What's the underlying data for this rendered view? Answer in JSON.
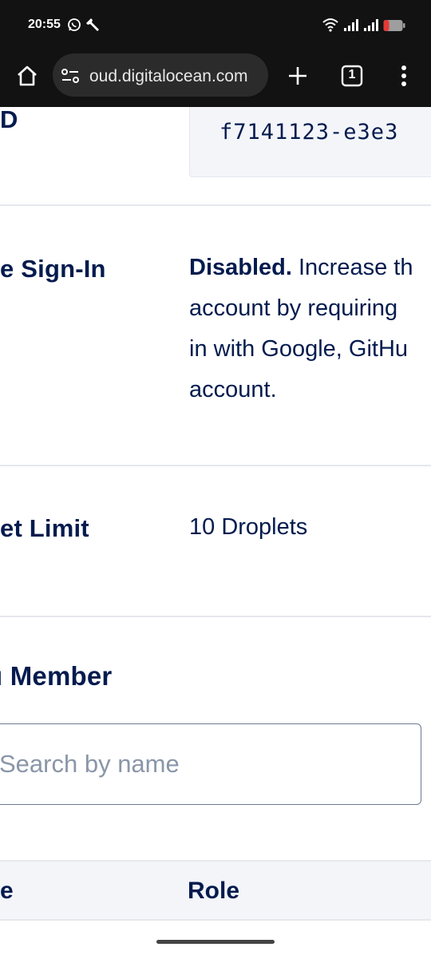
{
  "status_bar": {
    "time": "20:55",
    "icons": [
      "whatsapp-icon",
      "wrench-icon",
      "wifi-icon",
      "signal-icon",
      "signal-icon",
      "battery-low-icon"
    ],
    "battery_color": "#e53935"
  },
  "browser": {
    "url": "oud.digitalocean.com",
    "tab_count": "1",
    "icons": [
      "home-icon",
      "site-settings-icon",
      "new-tab-icon",
      "tabs-icon",
      "more-menu-icon"
    ]
  },
  "settings": {
    "id_row": {
      "label": "D",
      "value": "f7141123-e3e3"
    },
    "signin_row": {
      "label": "e Sign-In",
      "status": "Disabled.",
      "desc_line1": " Increase th",
      "desc_line2": "account by requiring",
      "desc_line3": "in with Google, GitHu",
      "desc_line4": "account."
    },
    "limit_row": {
      "label": "et Limit",
      "value": "10 Droplets"
    }
  },
  "members": {
    "heading": "ı Member",
    "search_placeholder": "Search by name",
    "columns": [
      "e",
      "Role"
    ]
  },
  "colors": {
    "text": "#031b4e",
    "divider": "#e5e8ed",
    "panel": "#f3f5f9",
    "browser_chrome": "#121212"
  }
}
